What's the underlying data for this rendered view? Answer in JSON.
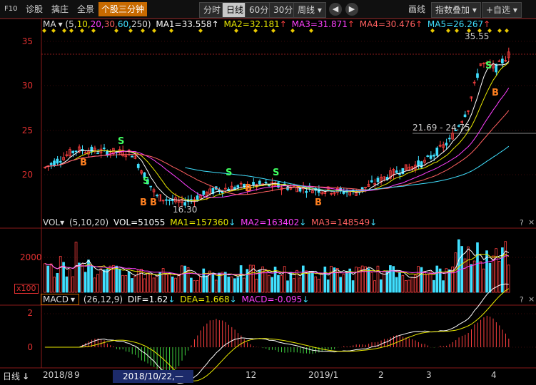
{
  "toolbar": {
    "f10": "F10",
    "items": [
      "诊股",
      "擒庄",
      "全景",
      "个股三分钟"
    ],
    "periods": [
      "分时",
      "日线",
      "60分",
      "30分",
      "周线"
    ],
    "period_dropdown": "▾",
    "prev": "◀",
    "next": "▶",
    "draw": "画线",
    "overlay": "指数叠加",
    "custom": "+自选"
  },
  "main_legend": {
    "name": "MA",
    "params_prefix": "(5,",
    "p10": "10,",
    "p20": "20,",
    "p30": "30,",
    "p60": "60,",
    "p250": "250)",
    "ma1": "MA1=33.558",
    "ma2": "MA2=32.181",
    "ma3": "MA3=31.871",
    "ma4": "MA4=30.476",
    "ma5": "MA5=26.267",
    "up": "↑",
    "down": "↓"
  },
  "vol_legend": {
    "name": "VOL",
    "params": "(5,10,20)",
    "vol": "VOL=51055",
    "ma1": "MA1=157360",
    "ma2": "MA2=163402",
    "ma3": "MA3=148549",
    "down": "↓"
  },
  "macd_legend": {
    "name": "MACD",
    "params": "(26,12,9)",
    "dif": "DIF=1.62",
    "dea": "DEA=1.668",
    "macd": "MACD=-0.095",
    "down": "↓"
  },
  "panel_controls": {
    "help": "?",
    "close": "×"
  },
  "price_axis": {
    "labels": [
      "35",
      "30",
      "25",
      "20"
    ]
  },
  "vol_axis": {
    "labels": [
      "2000"
    ],
    "unit": "x100"
  },
  "macd_axis": {
    "labels": [
      "2",
      "0"
    ]
  },
  "annotations": {
    "high": "35.55",
    "low": "16.30",
    "range": "21.69 - 24.75"
  },
  "signals": {
    "buy": "B",
    "sell": "S"
  },
  "xaxis": {
    "period_label": "日线",
    "labels": [
      "2018/8",
      "9",
      "12",
      "2019/1",
      "2",
      "3",
      "4"
    ],
    "cursor_date": "2018/10/22,—"
  },
  "colors": {
    "ma1": "#ffffff",
    "ma2": "#e8e800",
    "ma3": "#ff40ff",
    "ma4": "#ff6060",
    "ma5": "#40e0ff",
    "up": "#ff4040",
    "down": "#40e0ff",
    "accent": "#c86a00"
  }
}
